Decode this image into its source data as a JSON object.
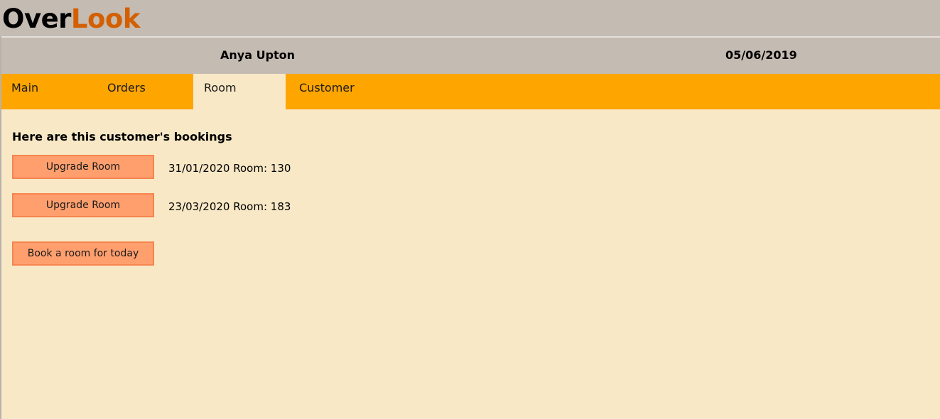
{
  "brand": {
    "logo_part1": "Over",
    "logo_part2": "Look"
  },
  "header": {
    "customer_name": "Anya Upton",
    "date": "05/06/2019"
  },
  "tabs": [
    {
      "label": "Main",
      "active": false
    },
    {
      "label": "Orders",
      "active": false
    },
    {
      "label": "Room",
      "active": true
    },
    {
      "label": "Customer",
      "active": false
    }
  ],
  "room_panel": {
    "heading": "Here are this customer's bookings",
    "bookings": [
      {
        "button_label": "Upgrade Room",
        "date": "31/01/2020",
        "room_text": "Room: 130"
      },
      {
        "button_label": "Upgrade Room",
        "date": "23/03/2020",
        "room_text": "Room: 183"
      }
    ],
    "book_today_label": "Book a room for today"
  },
  "colors": {
    "header_bg": "#c4bbb2",
    "tab_bar": "#ffa500",
    "content_bg": "#f8e8c6",
    "logo_accent": "#d35f00",
    "button_bg": "#ff9f6e"
  }
}
